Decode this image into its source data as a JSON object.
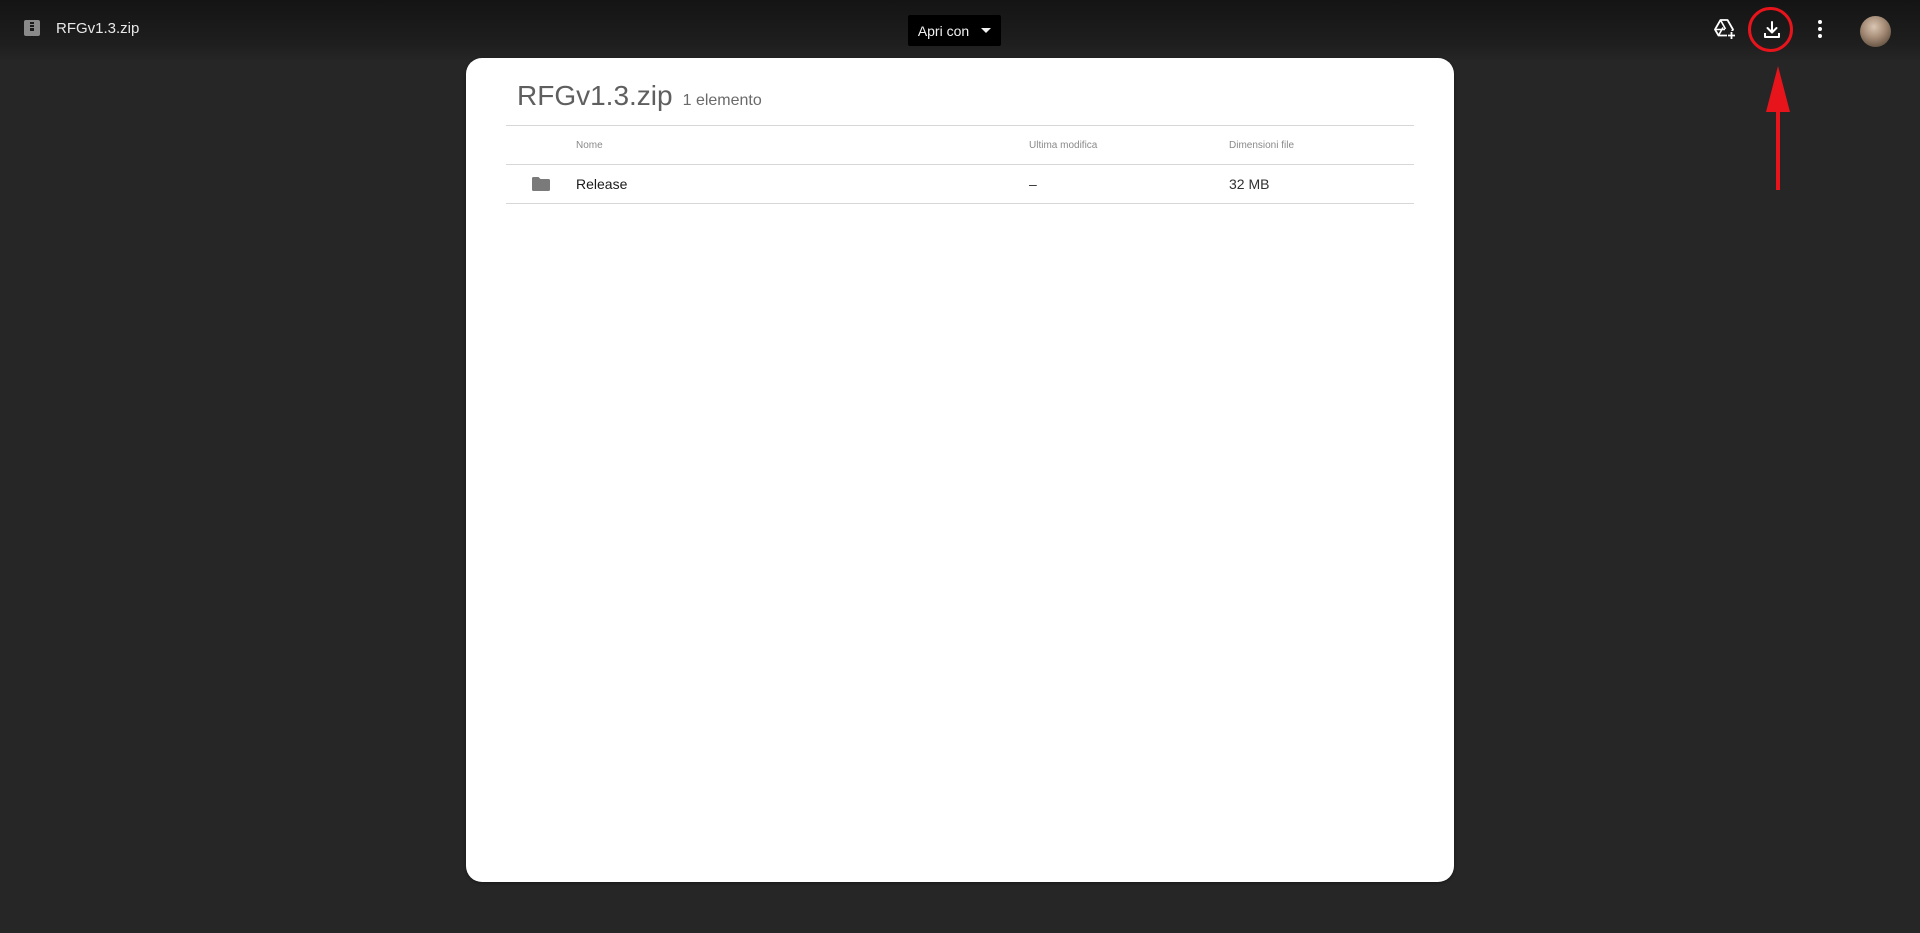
{
  "topbar": {
    "file_name": "RFGv1.3.zip",
    "open_with_label": "Apri con",
    "icons": {
      "file": "archive-file-icon",
      "drive_add": "add-to-drive-icon",
      "download": "download-icon",
      "more": "more-vert-icon",
      "avatar": "user-avatar"
    }
  },
  "annotation": {
    "highlight_color": "#e8141c"
  },
  "card": {
    "title": "RFGv1.3.zip",
    "item_count": "1 elemento",
    "columns": {
      "name": "Nome",
      "modified": "Ultima modifica",
      "size": "Dimensioni file"
    },
    "rows": [
      {
        "icon": "folder-icon",
        "name": "Release",
        "modified": "–",
        "size": "32 MB"
      }
    ]
  },
  "colors": {
    "background": "#262626",
    "card": "#ffffff",
    "button": "#000000"
  }
}
